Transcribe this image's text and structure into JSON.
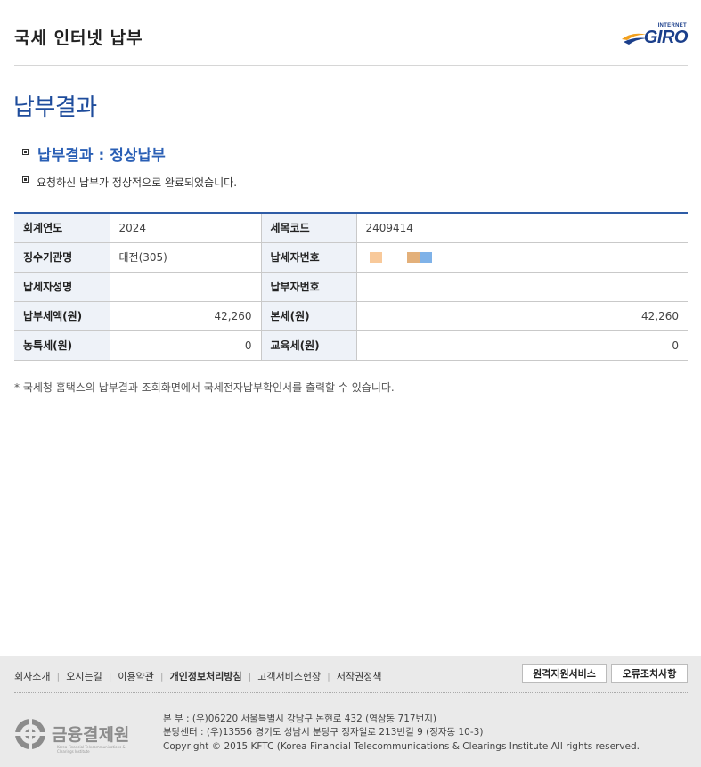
{
  "header": {
    "title": "국세 인터넷 납부",
    "logo_sub": "INTERNET",
    "logo_main": "GIRO"
  },
  "page_heading": "납부결과",
  "result": {
    "title": "납부결과 : 정상납부",
    "message": "요청하신 납부가 정상적으로 완료되었습니다."
  },
  "table": {
    "rows": [
      {
        "label1": "회계연도",
        "value1": "2024",
        "label2": "세목코드",
        "value2": "2409414"
      },
      {
        "label1": "징수기관명",
        "value1": "대전(305)",
        "label2": "납세자번호",
        "value2": ""
      },
      {
        "label1": "납세자성명",
        "value1": "",
        "label2": "납부자번호",
        "value2": ""
      },
      {
        "label1": "납부세액(원)",
        "value1": "42,260",
        "label2": "본세(원)",
        "value2": "42,260"
      },
      {
        "label1": "농특세(원)",
        "value1": "0",
        "label2": "교육세(원)",
        "value2": "0"
      }
    ]
  },
  "note": "* 국세청 홈택스의 납부결과 조회화면에서 국세전자납부확인서를 출력할 수 있습니다.",
  "footer": {
    "links": [
      "회사소개",
      "오시는길",
      "이용약관",
      "개인정보처리방침",
      "고객서비스헌장",
      "저작권정책"
    ],
    "remote_support_button": "원격지원서비스",
    "error_action_button": "오류조치사항",
    "org_name": "금융결제원",
    "org_name_en": "Korea Financial Telecommunications & Clearings Institute",
    "address_main": "본 부 : (우)06220 서울특별시 강남구 논현로 432 (역삼동 717번지)",
    "address_branch": "분당센터 : (우)13556 경기도 성남시 분당구 정자일로 213번길 9 (정자동 10-3)",
    "copyright": "Copyright © 2015 KFTC (Korea Financial Telecommunications & Clearings Institute All rights reserved."
  }
}
